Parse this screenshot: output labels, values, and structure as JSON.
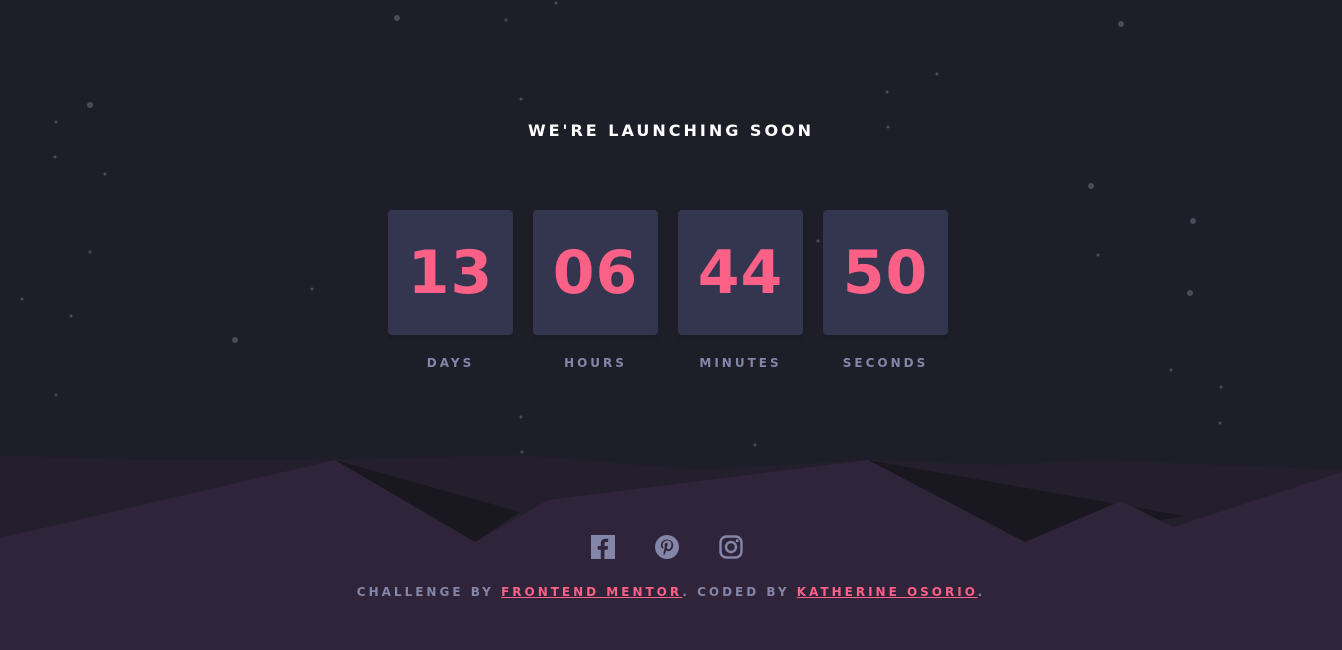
{
  "headline": "WE'RE LAUNCHING SOON",
  "countdown": [
    {
      "value": "13",
      "label": "DAYS"
    },
    {
      "value": "06",
      "label": "HOURS"
    },
    {
      "value": "44",
      "label": "MINUTES"
    },
    {
      "value": "50",
      "label": "SECONDS"
    }
  ],
  "social": [
    {
      "name": "facebook-icon"
    },
    {
      "name": "pinterest-icon"
    },
    {
      "name": "instagram-icon"
    }
  ],
  "footer": {
    "prefix": "CHALLENGE BY ",
    "link1": "FRONTEND MENTOR",
    "middle": ". CODED BY ",
    "link2": "KATHERINE OSORIO",
    "suffix": "."
  },
  "colors": {
    "background": "#1e1e28",
    "card": "#343650",
    "accent": "#fb6087",
    "muted": "#8385a9",
    "hill": "#2f2439"
  }
}
